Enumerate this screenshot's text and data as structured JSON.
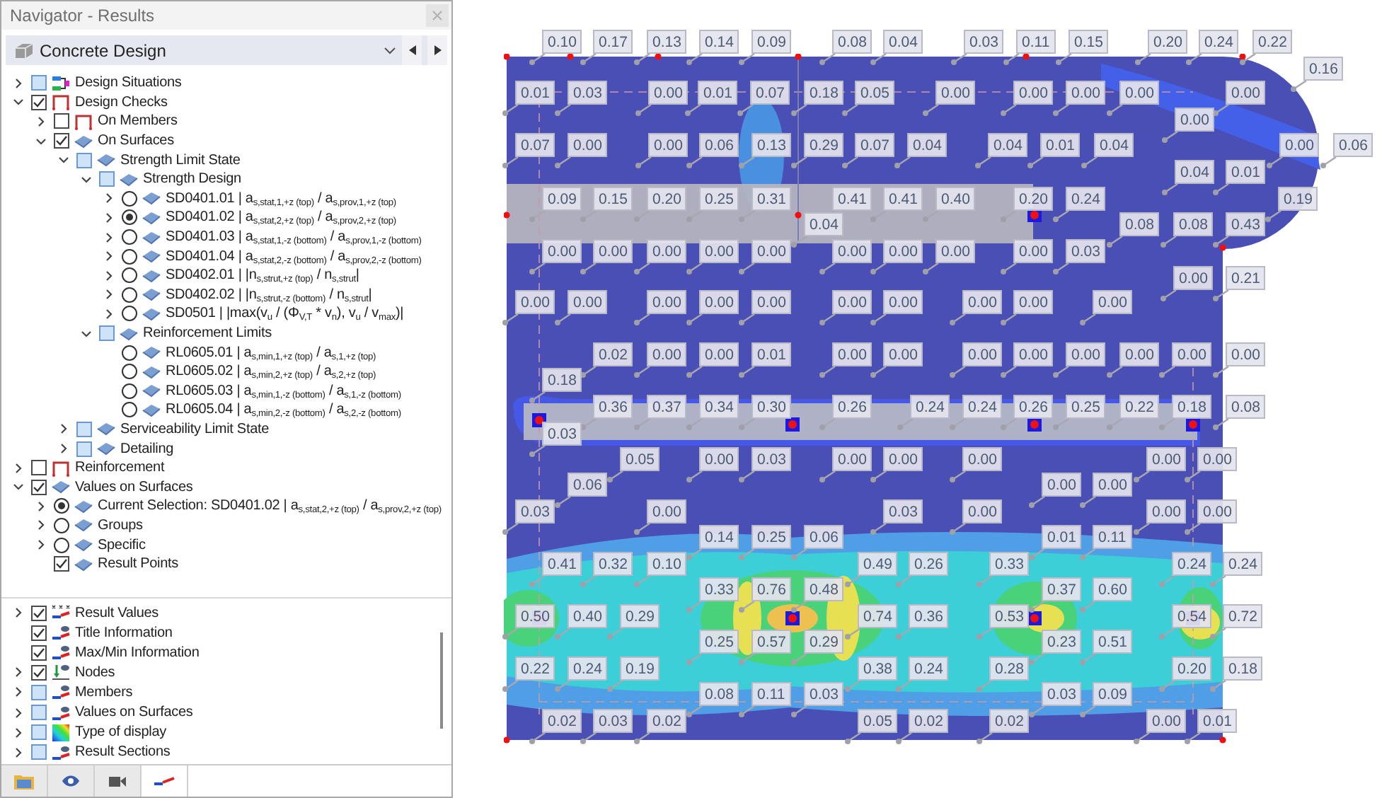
{
  "navigator": {
    "title": "Navigator - Results",
    "dropdown": "Concrete Design",
    "tree": [
      {
        "label": "Design Situations",
        "kind": "situations",
        "checked": false,
        "partial": true,
        "expanded": false
      },
      {
        "label": "Design Checks",
        "kind": "frame",
        "checked": true,
        "partial": false,
        "expanded": true,
        "children": [
          {
            "label": "On Members",
            "kind": "frame",
            "checked": false,
            "partial": false,
            "expanded": false
          },
          {
            "label": "On Surfaces",
            "kind": "surface",
            "checked": true,
            "partial": false,
            "expanded": true,
            "children": [
              {
                "label": "Strength Limit State",
                "kind": "surface",
                "checked": false,
                "partial": true,
                "expanded": true,
                "children": [
                  {
                    "label": "Strength Design",
                    "kind": "surface",
                    "checked": false,
                    "partial": true,
                    "expanded": true,
                    "children": [
                      {
                        "label": "SD0401.01 | a$_{s,stat,1,+z (top)}$ / a$_{s,prov,1,+z (top)}$",
                        "kind": "surface",
                        "selected": false,
                        "expanded": false
                      },
                      {
                        "label": "SD0401.02 | a$_{s,stat,2,+z (top)}$ / a$_{s,prov,2,+z (top)}$",
                        "kind": "surface",
                        "selected": true,
                        "expanded": false
                      },
                      {
                        "label": "SD0401.03 | a$_{s,stat,1,-z (bottom)}$ / a$_{s,prov,1,-z (bottom)}$",
                        "kind": "surface",
                        "selected": false,
                        "expanded": false
                      },
                      {
                        "label": "SD0401.04 | a$_{s,stat,2,-z (bottom)}$ / a$_{s,prov,2,-z (bottom)}$",
                        "kind": "surface",
                        "selected": false,
                        "expanded": false
                      },
                      {
                        "label": "SD0402.01 | |n$_{s,strut,+z (top)}$ / n$_{s,strut}$|",
                        "kind": "surface",
                        "selected": false,
                        "expanded": false
                      },
                      {
                        "label": "SD0402.02 | |n$_{s,strut,-z (bottom)}$ / n$_{s,strut}$|",
                        "kind": "surface",
                        "selected": false,
                        "expanded": false
                      },
                      {
                        "label": "SD0501 | |max(v$_{u}$ / (Φ$_{V,T}$ * v$_{n}$), v$_{u}$ / v$_{max}$)|",
                        "kind": "surface",
                        "selected": false,
                        "expanded": false
                      }
                    ]
                  },
                  {
                    "label": "Reinforcement Limits",
                    "kind": "surface",
                    "checked": false,
                    "partial": true,
                    "expanded": true,
                    "children": [
                      {
                        "label": "RL0605.01 | a$_{s,min,1,+z (top)}$ / a$_{s,1,+z (top)}$",
                        "kind": "surface",
                        "selected": false
                      },
                      {
                        "label": "RL0605.02 | a$_{s,min,2,+z (top)}$ / a$_{s,2,+z (top)}$",
                        "kind": "surface",
                        "selected": false
                      },
                      {
                        "label": "RL0605.03 | a$_{s,min,1,-z (bottom)}$ / a$_{s,1,-z (bottom)}$",
                        "kind": "surface",
                        "selected": false
                      },
                      {
                        "label": "RL0605.04 | a$_{s,min,2,-z (bottom)}$ / a$_{s,2,-z (bottom)}$",
                        "kind": "surface",
                        "selected": false
                      }
                    ]
                  }
                ]
              },
              {
                "label": "Serviceability Limit State",
                "kind": "surface",
                "checked": false,
                "partial": true,
                "expanded": false
              },
              {
                "label": "Detailing",
                "kind": "surface",
                "checked": false,
                "partial": true,
                "expanded": false
              }
            ]
          }
        ]
      },
      {
        "label": "Reinforcement",
        "kind": "frame",
        "checked": false,
        "partial": false,
        "expanded": false
      },
      {
        "label": "Values on Surfaces",
        "kind": "surface",
        "checked": true,
        "partial": false,
        "expanded": true,
        "children": [
          {
            "label": "Current Selection: SD0401.02 | a$_{s,stat,2,+z (top)}$ / a$_{s,prov,2,+z (top)}$",
            "kind": "surface",
            "selected": true,
            "expanded": false
          },
          {
            "label": "Groups",
            "kind": "surface",
            "selected": false,
            "expanded": false
          },
          {
            "label": "Specific",
            "kind": "surface",
            "selected": false,
            "expanded": false
          },
          {
            "label": "Result Points",
            "kind": "surface",
            "checked": true,
            "partial": false
          }
        ]
      }
    ],
    "display_tree": [
      {
        "label": "Result Values",
        "kind": "values",
        "checked": true,
        "partial": false,
        "expanded": false
      },
      {
        "label": "Title Information",
        "kind": "eye",
        "checked": true,
        "partial": false
      },
      {
        "label": "Max/Min Information",
        "kind": "eye",
        "checked": true,
        "partial": false
      },
      {
        "label": "Nodes",
        "kind": "nodes",
        "checked": true,
        "partial": false,
        "expanded": false
      },
      {
        "label": "Members",
        "kind": "eye",
        "checked": false,
        "partial": true,
        "expanded": false
      },
      {
        "label": "Values on Surfaces",
        "kind": "eye",
        "checked": false,
        "partial": true,
        "expanded": false
      },
      {
        "label": "Type of display",
        "kind": "palette",
        "checked": false,
        "partial": true,
        "expanded": false
      },
      {
        "label": "Result Sections",
        "kind": "eye",
        "checked": false,
        "partial": true,
        "expanded": false
      }
    ],
    "tabs": [
      {
        "kind": "data",
        "selected": false
      },
      {
        "kind": "view",
        "selected": false
      },
      {
        "kind": "camera",
        "selected": false
      },
      {
        "kind": "results",
        "selected": true
      }
    ]
  },
  "result_values": [
    [
      "0.10",
      "0.17",
      "0.13",
      "0.14",
      "0.09",
      "0.08",
      "0.04",
      "0.03",
      "0.11",
      "0.15",
      "0.20",
      "0.24",
      "0.22"
    ],
    [
      "0.16"
    ],
    [
      "0.01",
      "0.03",
      "0.00",
      "0.01",
      "0.07",
      "0.18",
      "0.05",
      "0.00",
      "0.00",
      "0.00",
      "0.00",
      "0.00"
    ],
    [
      "0.00"
    ],
    [
      "0.07",
      "0.00",
      "0.00",
      "0.06",
      "0.13",
      "0.29",
      "0.07",
      "0.04",
      "0.04",
      "0.01",
      "0.04",
      "0.00",
      "0.06"
    ],
    [
      "0.04",
      "0.01"
    ],
    [
      "0.09",
      "0.15",
      "0.20",
      "0.25",
      "0.31",
      "0.41",
      "0.41",
      "0.40",
      "0.20",
      "0.24",
      "0.19"
    ],
    [
      "0.04",
      "0.08",
      "0.08",
      "0.43"
    ],
    [
      "0.00",
      "0.00",
      "0.00",
      "0.00",
      "0.00",
      "0.00",
      "0.00",
      "0.00",
      "0.00",
      "0.03"
    ],
    [
      "0.00",
      "0.21"
    ],
    [
      "0.00",
      "0.00",
      "0.00",
      "0.00",
      "0.00",
      "0.00",
      "0.00",
      "0.00",
      "0.00",
      "0.00"
    ],
    [
      "0.02",
      "0.00",
      "0.00",
      "0.01",
      "0.00",
      "0.00",
      "0.00",
      "0.00",
      "0.00",
      "0.00",
      "0.00",
      "0.00"
    ],
    [
      "0.18"
    ],
    [
      "0.36",
      "0.37",
      "0.34",
      "0.30",
      "0.26",
      "0.24",
      "0.24",
      "0.26",
      "0.25",
      "0.22",
      "0.18",
      "0.08"
    ],
    [
      "0.03"
    ],
    [
      "0.05",
      "0.00",
      "0.03",
      "0.00",
      "0.00",
      "0.00",
      "0.00",
      "0.00"
    ],
    [
      "0.06",
      "0.00",
      "0.00"
    ],
    [
      "0.03",
      "0.00",
      "0.03",
      "0.00",
      "0.00",
      "0.00"
    ],
    [
      "0.14",
      "0.25",
      "0.06",
      "0.01",
      "0.11"
    ],
    [
      "0.41",
      "0.32",
      "0.10",
      "0.49",
      "0.26",
      "0.33",
      "0.24",
      "0.24"
    ],
    [
      "0.33",
      "0.76",
      "0.48",
      "0.37",
      "0.60"
    ],
    [
      "0.50",
      "0.40",
      "0.29",
      "0.74",
      "0.36",
      "0.53",
      "0.54",
      "0.72"
    ],
    [
      "0.25",
      "0.57",
      "0.29",
      "0.23",
      "0.51"
    ],
    [
      "0.22",
      "0.24",
      "0.19",
      "0.38",
      "0.24",
      "0.28",
      "0.20",
      "0.18"
    ],
    [
      "0.08",
      "0.11",
      "0.03",
      "0.03",
      "0.09"
    ],
    [
      "0.02",
      "0.03",
      "0.02",
      "0.05",
      "0.02",
      "0.02",
      "0.00",
      "0.01"
    ]
  ]
}
